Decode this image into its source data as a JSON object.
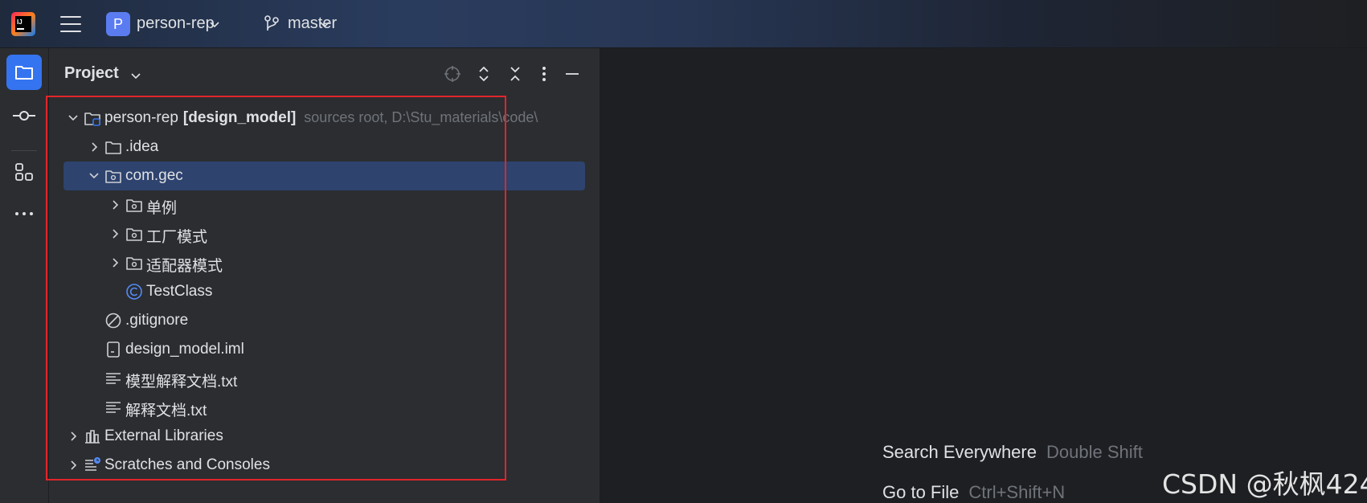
{
  "titlebar": {
    "project_badge": "P",
    "project_name": "person-rep",
    "branch_name": "master"
  },
  "panel": {
    "title": "Project"
  },
  "tree": [
    {
      "label": "person-rep",
      "bold": "[design_model]",
      "hint": "sources root,  D:\\Stu_materials\\code\\",
      "icon": "module-folder-icon",
      "arrow": "expanded"
    },
    {
      "label": ".idea",
      "icon": "folder-icon",
      "arrow": "collapsed"
    },
    {
      "label": "com.gec",
      "icon": "package-folder-icon",
      "arrow": "expanded",
      "selected": true
    },
    {
      "label": "单例",
      "icon": "package-folder-icon",
      "arrow": "collapsed"
    },
    {
      "label": "工厂模式",
      "icon": "package-folder-icon",
      "arrow": "collapsed"
    },
    {
      "label": "适配器模式",
      "icon": "package-folder-icon",
      "arrow": "collapsed"
    },
    {
      "label": "TestClass",
      "icon": "class-icon",
      "arrow": "none"
    },
    {
      "label": ".gitignore",
      "icon": "ignore-file-icon",
      "arrow": "none"
    },
    {
      "label": "design_model.iml",
      "icon": "iml-file-icon",
      "arrow": "none"
    },
    {
      "label": "模型解释文档.txt",
      "icon": "text-file-icon",
      "arrow": "none"
    },
    {
      "label": "解释文档.txt",
      "icon": "text-file-icon",
      "arrow": "none"
    },
    {
      "label": "External Libraries",
      "icon": "library-icon",
      "arrow": "collapsed"
    },
    {
      "label": "Scratches and Consoles",
      "icon": "scratches-icon",
      "arrow": "collapsed"
    }
  ],
  "editor": {
    "hints": [
      {
        "action": "Search Everywhere",
        "keys": "Double Shift"
      },
      {
        "action": "Go to File",
        "keys": "Ctrl+Shift+N"
      }
    ]
  },
  "watermark": "CSDN @秋枫424",
  "colors": {
    "accent": "#3574f0",
    "selection": "#2e436e",
    "annotation_box": "#e0262b"
  }
}
